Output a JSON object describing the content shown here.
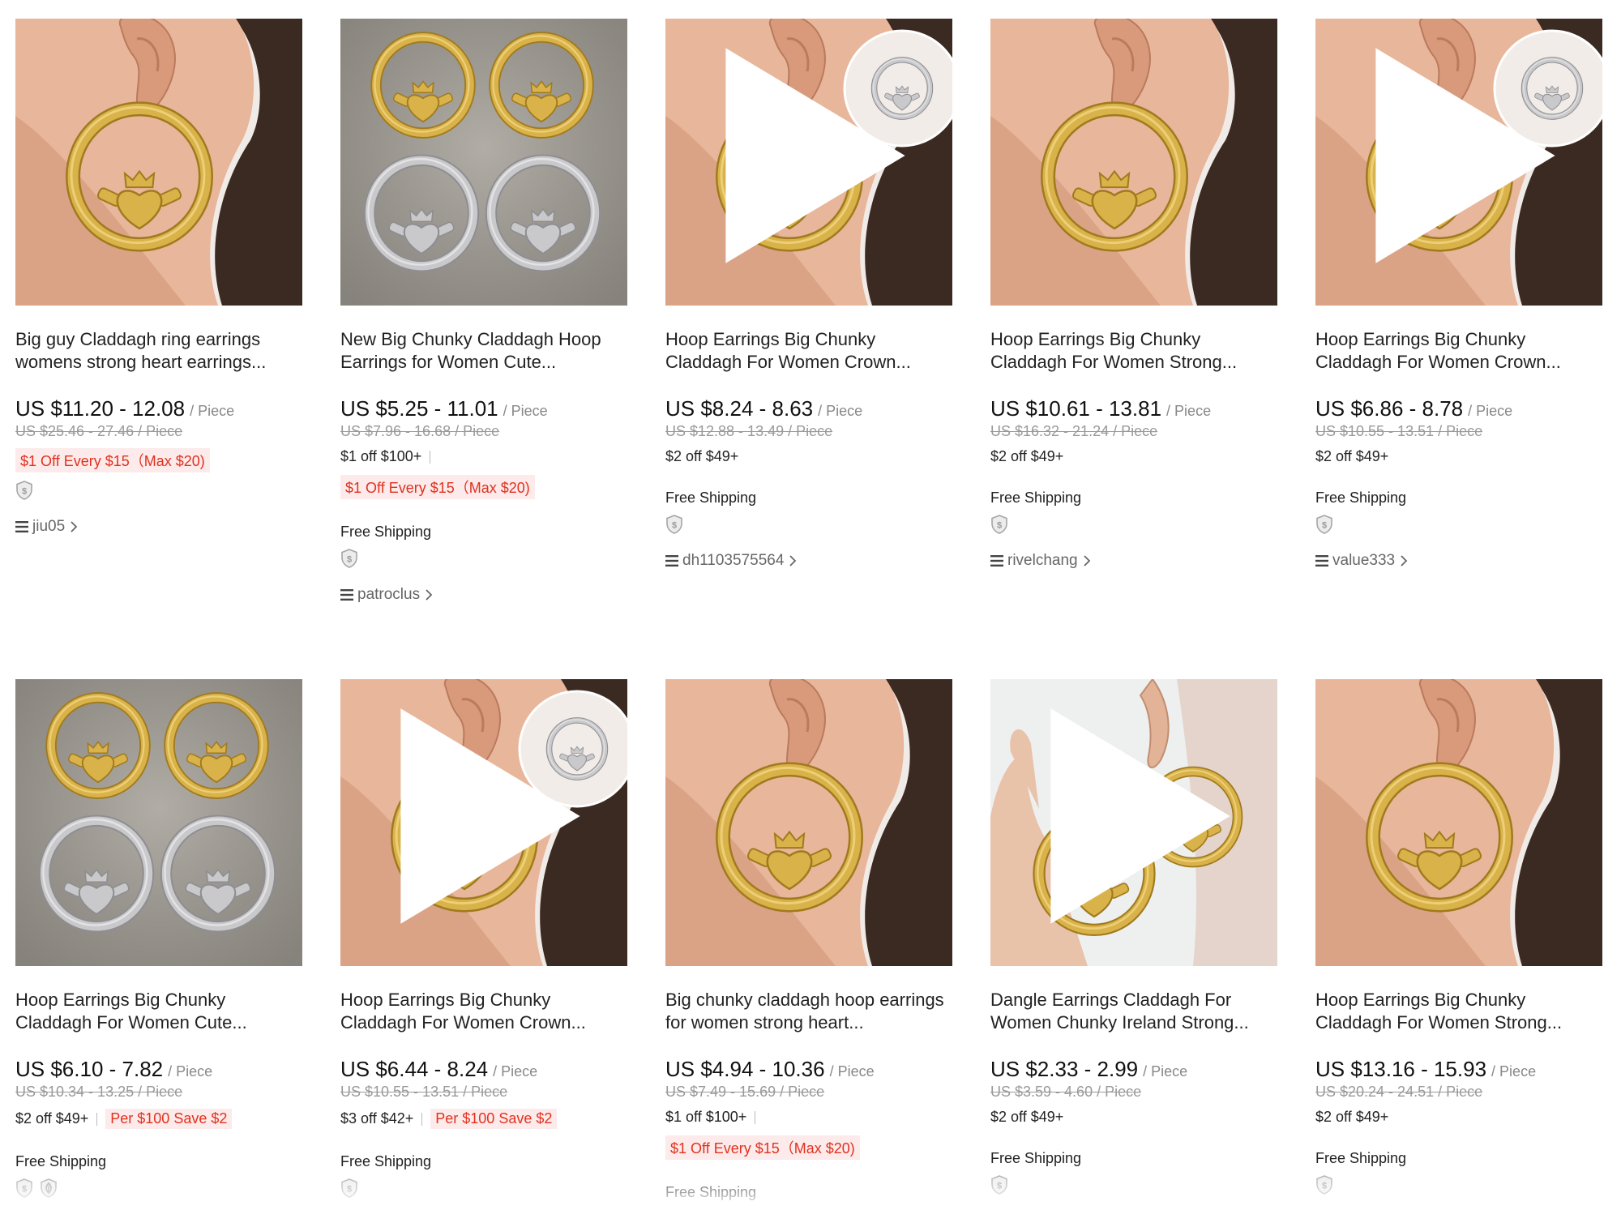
{
  "products": [
    {
      "title": "Big guy Claddagh ring earrings womens strong heart earrings...",
      "price": "US $11.20 - 12.08",
      "unit": "/ Piece",
      "original_price": "US $25.46 - 27.46 / Piece",
      "promo_text": "",
      "promo_tag": "$1 Off Every $15（Max $20)",
      "shipping": "",
      "badges": [
        "shield-dollar-icon"
      ],
      "store": "jiu05",
      "image": {
        "kind": "ear",
        "metal": "gold",
        "inset": false,
        "video": false
      }
    },
    {
      "title": "New Big Chunky Claddagh Hoop Earrings for Women Cute...",
      "price": "US $5.25 - 11.01",
      "unit": "/ Piece",
      "original_price": "US $7.96 - 16.68 / Piece",
      "promo_text": "$1 off $100+",
      "promo_tag": "$1 Off Every $15（Max $20)",
      "shipping": "Free Shipping",
      "badges": [
        "shield-dollar-icon"
      ],
      "store": "patroclus",
      "image": {
        "kind": "flat",
        "metal": "both",
        "inset": false,
        "video": false
      }
    },
    {
      "title": "Hoop Earrings Big Chunky Claddagh For Women Crown...",
      "price": "US $8.24 - 8.63",
      "unit": "/ Piece",
      "original_price": "US $12.88 - 13.49 / Piece",
      "promo_text": "$2 off $49+",
      "promo_tag": "",
      "shipping": "Free Shipping",
      "badges": [
        "shield-dollar-icon"
      ],
      "store": "dh1103575564",
      "image": {
        "kind": "ear",
        "metal": "gold",
        "inset": true,
        "video": true
      }
    },
    {
      "title": "Hoop Earrings Big Chunky Claddagh For Women Strong...",
      "price": "US $10.61 - 13.81",
      "unit": "/ Piece",
      "original_price": "US $16.32 - 21.24 / Piece",
      "promo_text": "$2 off $49+",
      "promo_tag": "",
      "shipping": "Free Shipping",
      "badges": [
        "shield-dollar-icon"
      ],
      "store": "rivelchang",
      "image": {
        "kind": "ear",
        "metal": "gold",
        "inset": false,
        "video": false
      }
    },
    {
      "title": "Hoop Earrings Big Chunky Claddagh For Women Crown...",
      "price": "US $6.86 - 8.78",
      "unit": "/ Piece",
      "original_price": "US $10.55 - 13.51 / Piece",
      "promo_text": "$2 off $49+",
      "promo_tag": "",
      "shipping": "Free Shipping",
      "badges": [
        "shield-dollar-icon"
      ],
      "store": "value333",
      "image": {
        "kind": "ear",
        "metal": "gold",
        "inset": true,
        "video": true
      }
    },
    {
      "title": "Hoop Earrings Big Chunky Claddagh For Women Cute...",
      "price": "US $6.10 - 7.82",
      "unit": "/ Piece",
      "original_price": "US $10.34 - 13.25 / Piece",
      "promo_text": "$2 off $49+",
      "promo_tag": "Per $100 Save $2",
      "shipping": "Free Shipping",
      "badges": [
        "shield-dollar-icon",
        "shield-leaf-icon"
      ],
      "store": "",
      "image": {
        "kind": "flat",
        "metal": "both",
        "inset": false,
        "video": false
      }
    },
    {
      "title": "Hoop Earrings Big Chunky Claddagh For Women Crown...",
      "price": "US $6.44 - 8.24",
      "unit": "/ Piece",
      "original_price": "US $10.55 - 13.51 / Piece",
      "promo_text": "$3 off $42+",
      "promo_tag": "Per $100 Save $2",
      "shipping": "Free Shipping",
      "badges": [
        "shield-dollar-icon"
      ],
      "store": "",
      "image": {
        "kind": "ear",
        "metal": "gold",
        "inset": true,
        "video": true
      }
    },
    {
      "title": "Big chunky claddagh hoop earrings for women strong heart...",
      "price": "US $4.94 - 10.36",
      "unit": "/ Piece",
      "original_price": "US $7.49 - 15.69 / Piece",
      "promo_text": "$1 off $100+",
      "promo_tag": "$1 Off Every $15（Max $20)",
      "shipping": "Free Shipping",
      "badges": [],
      "store": "",
      "image": {
        "kind": "ear",
        "metal": "gold",
        "inset": false,
        "video": false
      }
    },
    {
      "title": "Dangle Earrings Claddagh For Women Chunky Ireland Strong...",
      "price": "US $2.33 - 2.99",
      "unit": "/ Piece",
      "original_price": "US $3.59 - 4.60 / Piece",
      "promo_text": "$2 off $49+",
      "promo_tag": "",
      "shipping": "Free Shipping",
      "badges": [
        "shield-dollar-icon"
      ],
      "store": "",
      "image": {
        "kind": "hand",
        "metal": "gold",
        "inset": false,
        "video": true
      }
    },
    {
      "title": "Hoop Earrings Big Chunky Claddagh For Women Strong...",
      "price": "US $13.16 - 15.93",
      "unit": "/ Piece",
      "original_price": "US $20.24 - 24.51 / Piece",
      "promo_text": "$2 off $49+",
      "promo_tag": "",
      "shipping": "Free Shipping",
      "badges": [
        "shield-dollar-icon"
      ],
      "store": "",
      "image": {
        "kind": "ear",
        "metal": "gold",
        "inset": false,
        "video": false
      }
    }
  ],
  "colors": {
    "promo_red": "#e0321f",
    "promo_bg": "#fdeaea",
    "gold": "#d9b24a",
    "silver": "#c9c9cb",
    "skin": "#d99a7c",
    "hair": "#3b2a22"
  }
}
